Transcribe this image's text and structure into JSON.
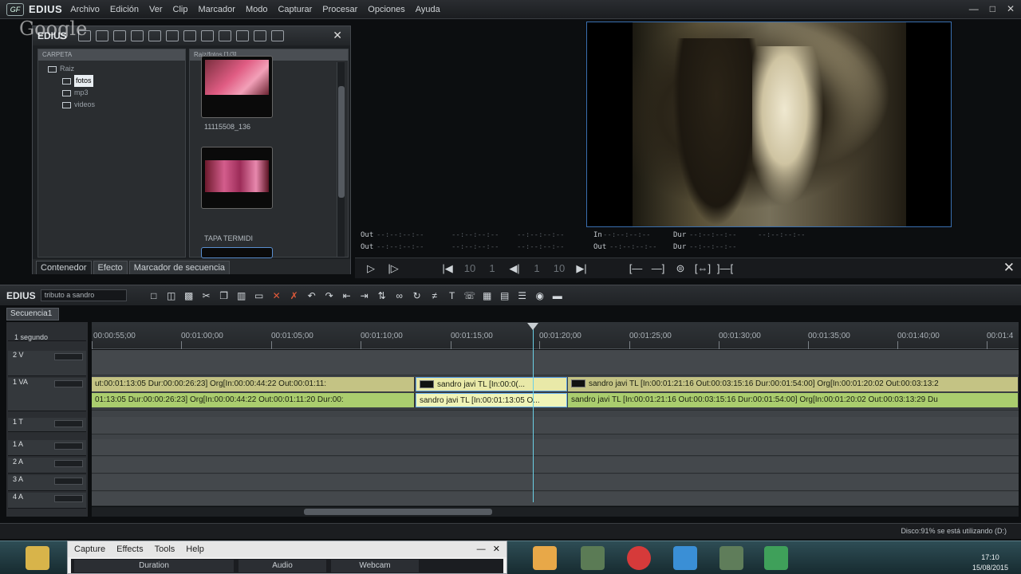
{
  "app": {
    "brand": "EDIUS",
    "logo": "GF",
    "menu": [
      "Archivo",
      "Edición",
      "Ver",
      "Clip",
      "Marcador",
      "Modo",
      "Capturar",
      "Procesar",
      "Opciones",
      "Ayuda"
    ]
  },
  "watermark": "Google",
  "bin": {
    "title": "EDIUS",
    "folder_header": "CARPETA",
    "clip_header": "Raiz/fotos [1/3]",
    "tree": {
      "root": "Raiz",
      "items": [
        "fotos",
        "mp3",
        "videos"
      ]
    },
    "thumbs": [
      {
        "label": "11115508_136"
      },
      {
        "label": "TAPA TERMIDI"
      }
    ],
    "tabs": [
      "Contenedor",
      "Efecto",
      "Marcador de secuencia"
    ]
  },
  "timecodes": {
    "row1": {
      "out": "Out",
      "in": "In",
      "dur": "Dur"
    },
    "row2": {
      "out": "Out",
      "out2": "Out",
      "dur": "Dur"
    },
    "blank": "--:--:--:--"
  },
  "transport": {
    "nums": [
      "10",
      "1",
      "1",
      "10"
    ]
  },
  "timeline": {
    "title": "EDIUS",
    "project": "tributo a sandro",
    "sequence_tab": "Secuencia1",
    "scale": "1 segundo",
    "ruler": [
      "00:00:55;00",
      "00:01:00;00",
      "00:01:05;00",
      "00:01:10;00",
      "00:01:15;00",
      "00:01:20;00",
      "00:01:25;00",
      "00:01:30;00",
      "00:01:35;00",
      "00:01:40;00",
      "00:01:4"
    ],
    "tracks": [
      {
        "name": "2 V"
      },
      {
        "name": "1 VA"
      },
      {
        "name": "1 T"
      },
      {
        "name": "1 A"
      },
      {
        "name": "2 A"
      },
      {
        "name": "3 A"
      },
      {
        "name": "4 A"
      }
    ],
    "clips_v": [
      "ut:00:01:13:05 Dur:00:00:26:23]  Org[In:00:00:44:22 Out:00:01:11:",
      "sandro javi  TL [In:00:0(...",
      "sandro javi  TL [In:00:01:21:16 Out:00:03:15:16 Dur:00:01:54:00]  Org[In:00:01:20:02 Out:00:03:13:2"
    ],
    "clips_a": [
      "01:13:05 Dur:00:00:26:23]  Org[In:00:00:44:22 Out:00:01:11:20 Dur:00:",
      "sandro javi  TL [In:00:01:13:05 O...",
      "sandro javi  TL [In:00:01:21:16 Out:00:03:15:16 Dur:00:01:54:00]  Org[In:00:01:20:02 Out:00:03:13:29 Du"
    ]
  },
  "status": {
    "disk": "Disco:91% se está utilizando (D:)"
  },
  "popup": {
    "menu": [
      "Capture",
      "Effects",
      "Tools",
      "Help"
    ],
    "tabs": [
      "Duration",
      "Audio",
      "Webcam"
    ]
  },
  "clock": {
    "time": "17:10",
    "date": "15/08/2015"
  }
}
